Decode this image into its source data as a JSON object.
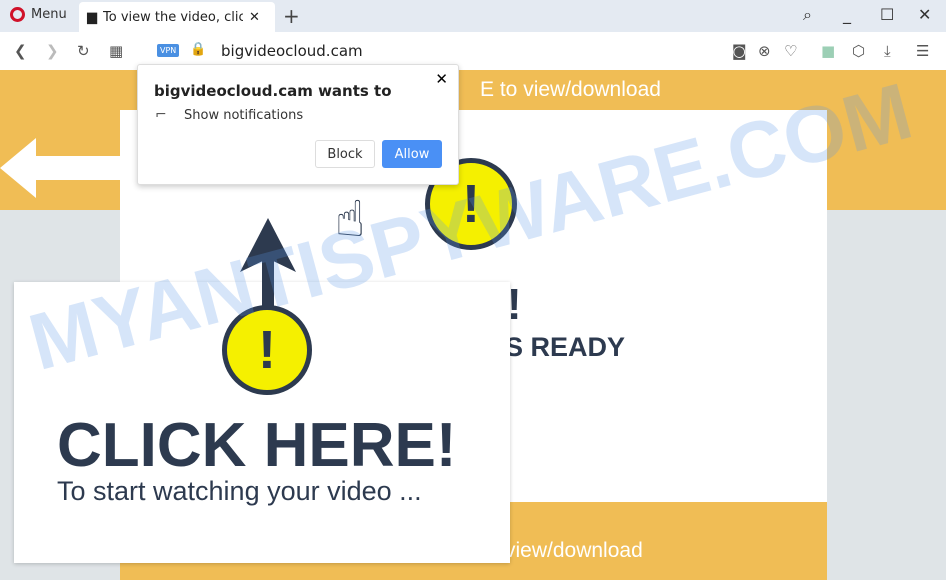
{
  "browser": {
    "menu_label": "Menu",
    "tab_title": "To view the video, click",
    "url": "bigvideocloud.cam",
    "vpn_label": "VPN"
  },
  "page": {
    "header_text": "E to view/download",
    "footer_text": "view/download",
    "partial_headline": "T!",
    "partial_sub": "S READY"
  },
  "popup": {
    "headline": "CLICK HERE!",
    "subline": "To start watching your video ..."
  },
  "notification": {
    "title": "bigvideocloud.cam wants to",
    "permission": "Show notifications",
    "block_label": "Block",
    "allow_label": "Allow"
  },
  "watermark": "MYANTISPYWARE.COM",
  "colors": {
    "orange": "#f0bd55",
    "navy": "#2d3a4f",
    "allow_blue": "#4a90f5"
  }
}
